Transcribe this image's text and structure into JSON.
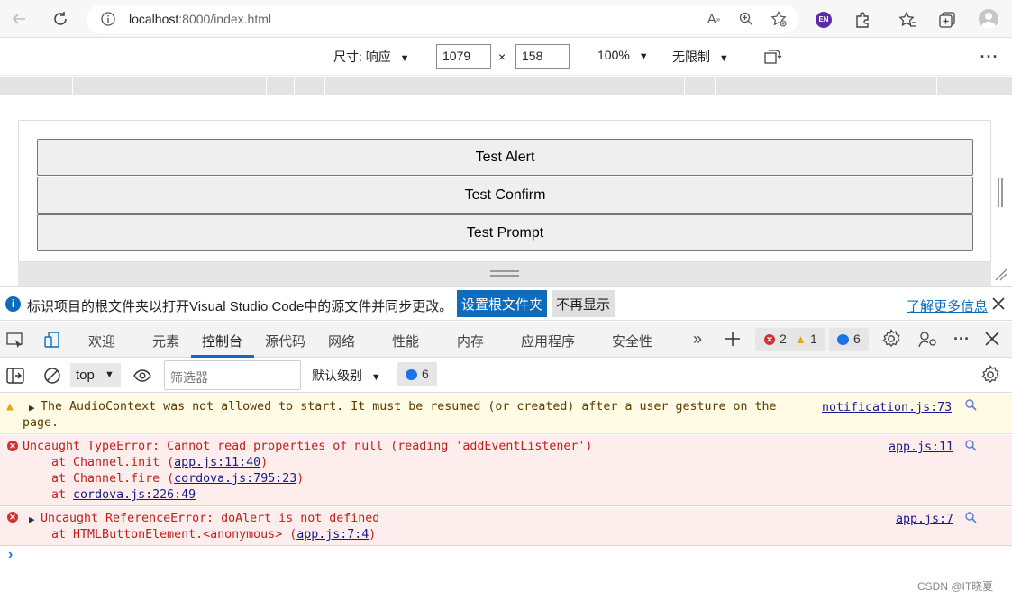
{
  "browser": {
    "url_host": "localhost",
    "url_path": ":8000/index.html",
    "profile_badge": "EN"
  },
  "device_toolbar": {
    "dimensions_label": "尺寸: 响应",
    "width_value": "1079",
    "times": "×",
    "height_value": "158",
    "zoom_label": "100%",
    "throttle_label": "无限制"
  },
  "page": {
    "buttons": [
      "Test Alert",
      "Test Confirm",
      "Test Prompt"
    ]
  },
  "infobar": {
    "message": "标识项目的根文件夹以打开Visual Studio Code中的源文件并同步更改。",
    "set_root_label": "设置根文件夹",
    "dont_show_label": "不再显示",
    "learn_more_label": "了解更多信息"
  },
  "devtools": {
    "tabs": [
      "欢迎",
      "元素",
      "控制台",
      "源代码",
      "网络",
      "性能",
      "内存",
      "应用程序",
      "安全性"
    ],
    "error_count": "2",
    "warning_count": "1",
    "info_count": "6"
  },
  "console_toolbar": {
    "context": "top",
    "filter_placeholder": "筛选器",
    "levels_label": "默认级别",
    "issues_count": "6"
  },
  "messages": {
    "warn": {
      "text1": "The AudioContext was not allowed to start. It must be resumed (or created) after a user gesture on the",
      "text2": "page.",
      "source": "notification.js:73"
    },
    "err1": {
      "text": "Uncaught TypeError: Cannot read properties of null (reading 'addEventListener')",
      "stack1_pre": "    at Channel.init (",
      "stack1_link": "app.js:11:40",
      "stack2_pre": "    at Channel.fire (",
      "stack2_link": "cordova.js:795:23",
      "stack3_pre": "    at ",
      "stack3_link": "cordova.js:226:49",
      "close_paren": ")",
      "source": "app.js:11"
    },
    "err2": {
      "text": "Uncaught ReferenceError: doAlert is not defined",
      "stack1_pre": "    at HTMLButtonElement.<anonymous> (",
      "stack1_link": "app.js:7:4",
      "close_paren": ")",
      "source": "app.js:7"
    }
  },
  "watermark": "CSDN @IT晓夏"
}
